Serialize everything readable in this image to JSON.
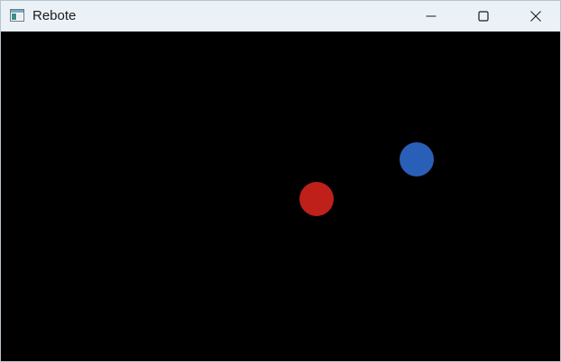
{
  "window": {
    "title": "Rebote",
    "controls": {
      "minimize_icon": "minimize-icon",
      "maximize_icon": "maximize-icon",
      "close_icon": "close-icon"
    }
  },
  "scene": {
    "background_color": "#000000",
    "balls": [
      {
        "name": "red-ball",
        "color": "#c0201a"
      },
      {
        "name": "blue-ball",
        "color": "#2a5fb8"
      }
    ]
  }
}
